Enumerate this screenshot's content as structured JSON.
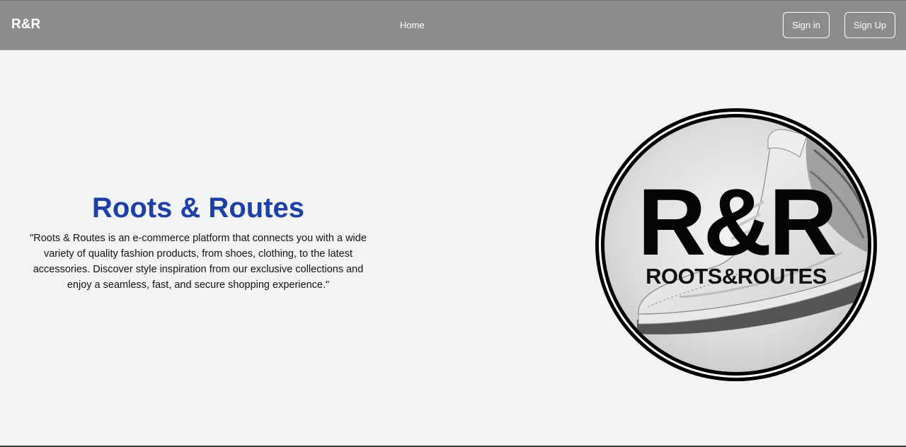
{
  "navbar": {
    "brand": "R&R",
    "links": [
      {
        "label": "Home"
      }
    ],
    "sign_in_label": "Sign in",
    "sign_up_label": "Sign Up"
  },
  "hero": {
    "title": "Roots & Routes",
    "description": "\"Roots & Routes is an e-commerce platform that connects you with a wide variety of quality fashion products, from shoes, clothing, to the latest accessories. Discover style inspiration from our exclusive collections and enjoy a seamless, fast, and secure shopping experience.\""
  },
  "logo": {
    "monogram": "R&R",
    "wordmark": "ROOTS&ROUTES"
  },
  "colors": {
    "navbar_bg": "#8b8c8e",
    "page_bg": "#f2f3f5",
    "title_blue": "#1e40a6"
  }
}
